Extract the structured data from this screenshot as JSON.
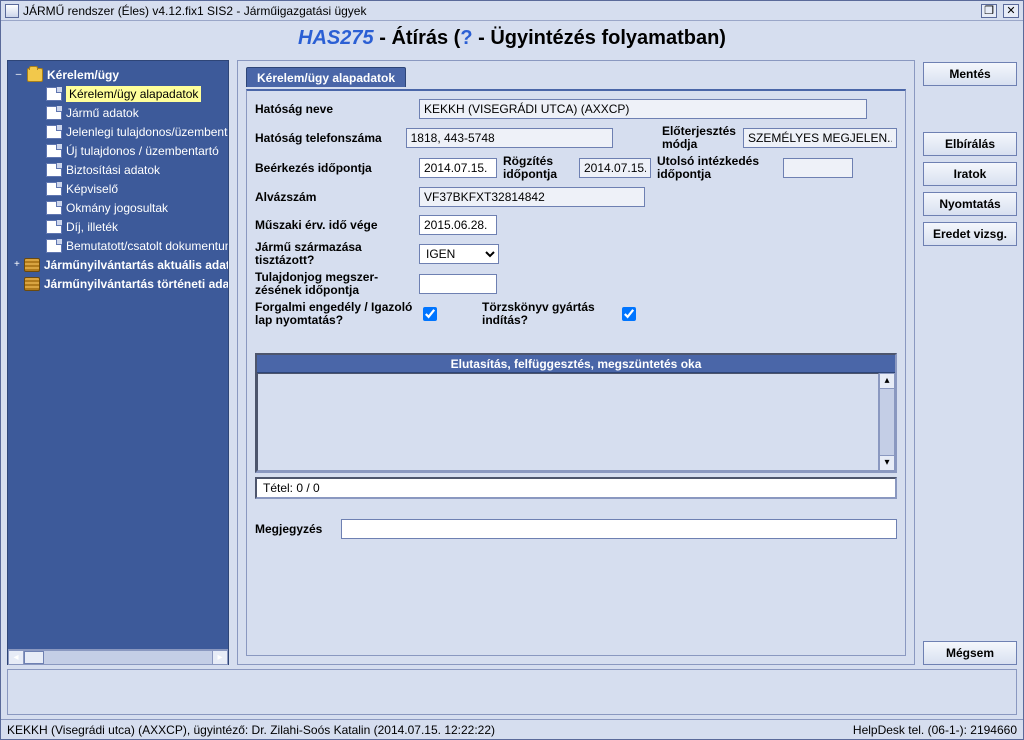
{
  "window": {
    "title": "JÁRMŰ rendszer (Éles) v4.12.fix1 SIS2 - Járműigazgatási ügyek"
  },
  "header": {
    "code": "HAS275",
    "sep": " - ",
    "main": "Átírás (",
    "q": "?",
    "tail": " - Ügyintézés folyamatban)"
  },
  "tree": {
    "root": "Kérelem/ügy",
    "items": [
      "Kérelem/ügy alapadatok",
      "Jármű adatok",
      "Jelenlegi tulajdonos/üzembentartó",
      "Új tulajdonos / üzembentartó",
      "Biztosítási adatok",
      "Képviselő",
      "Okmány jogosultak",
      "Díj, illeték",
      "Bemutatott/csatolt dokumentumok"
    ],
    "extra1": "Járműnyilvántartás aktuális adatai",
    "extra2": "Járműnyilvántartás történeti adatai"
  },
  "tab": {
    "label": "Kérelem/ügy alapadatok"
  },
  "form": {
    "hatosag_neve_lbl": "Hatóság neve",
    "hatosag_neve": "KEKKH (VISEGRÁDI UTCA) (AXXCP)",
    "hatosag_tel_lbl": "Hatóság telefonszáma",
    "hatosag_tel": "1818, 443-5748",
    "eloterj_lbl": "Előterjesztés módja",
    "eloterj": "SZEMÉLYES MEGJELEN...",
    "beerk_lbl": "Beérkezés időpontja",
    "beerk": "2014.07.15.",
    "rogz_lbl": "Rögzítés időpontja",
    "rogz": "2014.07.15.",
    "utolso_lbl": "Utolsó intézkedés időpontja",
    "utolso": "",
    "alvaz_lbl": "Alvázszám",
    "alvaz": "VF37BKFXT32814842",
    "muszaki_lbl": "Műszaki érv. idő vége",
    "muszaki": "2015.06.28.",
    "szarm_lbl": "Jármű származása tisztázott?",
    "szarm_val": "IGEN",
    "tulaj_lbl": "Tulajdonjog megszer-zésének időpontja",
    "tulaj": "",
    "forg_lbl": "Forgalmi engedély / Igazoló lap nyomtatás?",
    "torzs_lbl": "Törzskönyv gyártás indítás?",
    "reason_header": "Elutasítás, felfüggesztés, megszüntetés oka",
    "reason_footer": "Tétel: 0 / 0",
    "megj_lbl": "Megjegyzés",
    "megj": ""
  },
  "buttons": {
    "mentes": "Mentés",
    "elbiralas": "Elbírálás",
    "iratok": "Iratok",
    "nyomtatas": "Nyomtatás",
    "eredet": "Eredet vizsg.",
    "megsem": "Mégsem"
  },
  "status": {
    "left": "KEKKH (Visegrádi utca) (AXXCP), ügyintéző: Dr. Zilahi-Soós Katalin (2014.07.15. 12:22:22)",
    "right": "HelpDesk tel. (06-1-): 2194660"
  }
}
